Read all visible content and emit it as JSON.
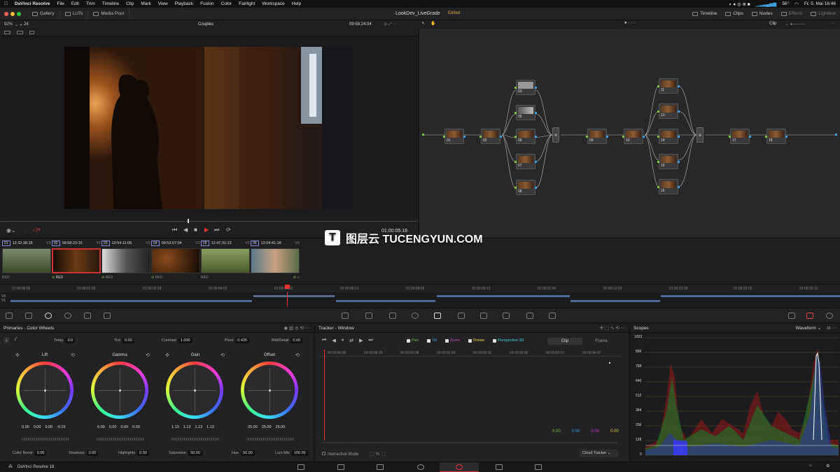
{
  "menubar": {
    "app": "DaVinci Resolve",
    "items": [
      "File",
      "Edit",
      "Trim",
      "Timeline",
      "Clip",
      "Mark",
      "View",
      "Playback",
      "Fusion",
      "Color",
      "Fairlight",
      "Workspace",
      "Help"
    ],
    "temperature": "56°",
    "datetime": "Fr. 5. Mai 16:46"
  },
  "toolbar": {
    "gallery": "Gallery",
    "luts": "LUTs",
    "media_pool": "Media Pool",
    "project_title": "LookDev_LiveGrade",
    "project_status": "Edited",
    "timeline": "Timeline",
    "clips": "Clips",
    "nodes": "Nodes",
    "effects": "Effects",
    "lightbox": "Lightbox"
  },
  "viewer": {
    "zoom": "92%",
    "fps": "24",
    "timeline_name": "Couples",
    "timecode": "09:58:24:04",
    "playhead_tc": "01:00:05:18"
  },
  "nodegraph": {
    "mode": "Clip",
    "nodes": [
      "01",
      "02",
      "03",
      "05",
      "06",
      "07",
      "08",
      "09",
      "10",
      "11",
      "13",
      "14",
      "15",
      "16",
      "17",
      "18"
    ]
  },
  "clips": [
    {
      "num": "01",
      "tc": "12:32:38:18",
      "track": "V1",
      "label": "RED"
    },
    {
      "num": "02",
      "tc": "09:58:23:10",
      "track": "V1",
      "label": "RED"
    },
    {
      "num": "03",
      "tc": "10:54:11:06",
      "track": "V1",
      "label": "RED"
    },
    {
      "num": "04",
      "tc": "09:53:07:04",
      "track": "V2",
      "label": "RED"
    },
    {
      "num": "05",
      "tc": "12:47:31:13",
      "track": "V1",
      "label": "RED"
    },
    {
      "num": "06",
      "tc": "13:04:41:18",
      "track": "V2",
      "label": ""
    }
  ],
  "ruler": [
    "01:00:00:00",
    "01:00:01:09",
    "01:00:02:18",
    "01:00:04:03",
    "01:00:05:12",
    "01:00:06:21",
    "01:00:08:06",
    "01:00:09:15",
    "01:00:11:00",
    "01:00:12:09",
    "01:00:13:18",
    "01:00:15:03",
    "01:00:16:12"
  ],
  "primaries": {
    "title": "Primaries - Color Wheels",
    "temp_label": "Temp",
    "temp": "0.0",
    "tint_label": "Tint",
    "tint": "0.00",
    "contrast_label": "Contrast",
    "contrast": "1.000",
    "pivot_label": "Pivot",
    "pivot": "0.435",
    "middetail_label": "Mid/Detail",
    "middetail": "0.00",
    "wheels": [
      {
        "name": "Lift",
        "values": [
          "0.00",
          "0.00",
          "0.00",
          "-0.01"
        ]
      },
      {
        "name": "Gamma",
        "values": [
          "0.00",
          "0.00",
          "0.00",
          "0.00"
        ]
      },
      {
        "name": "Gain",
        "values": [
          "1.13",
          "1.13",
          "1.13",
          "1.13"
        ]
      },
      {
        "name": "Offset",
        "values": [
          "25.00",
          "25.00",
          "25.00"
        ]
      }
    ],
    "colorboost_label": "Color Boost",
    "colorboost": "0.00",
    "shadows_label": "Shadows",
    "shadows": "0.00",
    "highlights_label": "Highlights",
    "highlights": "0.00",
    "saturation_label": "Saturation",
    "saturation": "50.00",
    "hue_label": "Hue",
    "hue": "50.00",
    "lummix_label": "Lum Mix",
    "lummix": "100.00"
  },
  "tracker": {
    "title": "Tracker - Window",
    "checks": [
      "Pan",
      "Tilt",
      "Zoom",
      "Rotate",
      "Perspective 3D"
    ],
    "tab_clip": "Clip",
    "tab_frame": "Frame",
    "ruler": [
      "00:00:00:00",
      "00:00:00:15",
      "00:00:01:06",
      "00:00:01:20",
      "00:00:02:11",
      "00:00:03:02",
      "00:00:03:17",
      "00:00:04:07"
    ],
    "values": [
      "0.00",
      "0.00",
      "0.00",
      "0.00"
    ],
    "interactive_mode": "Interactive Mode",
    "cloud_tracker": "Cloud Tracker"
  },
  "scopes": {
    "title": "Scopes",
    "mode": "Waveform",
    "scale": [
      "1023",
      "896",
      "768",
      "640",
      "512",
      "384",
      "256",
      "128",
      "0"
    ]
  },
  "bottombar": {
    "app": "DaVinci Resolve 18"
  },
  "watermark": {
    "logo": "T",
    "text": "图层云 TUCENGYUN.COM"
  }
}
